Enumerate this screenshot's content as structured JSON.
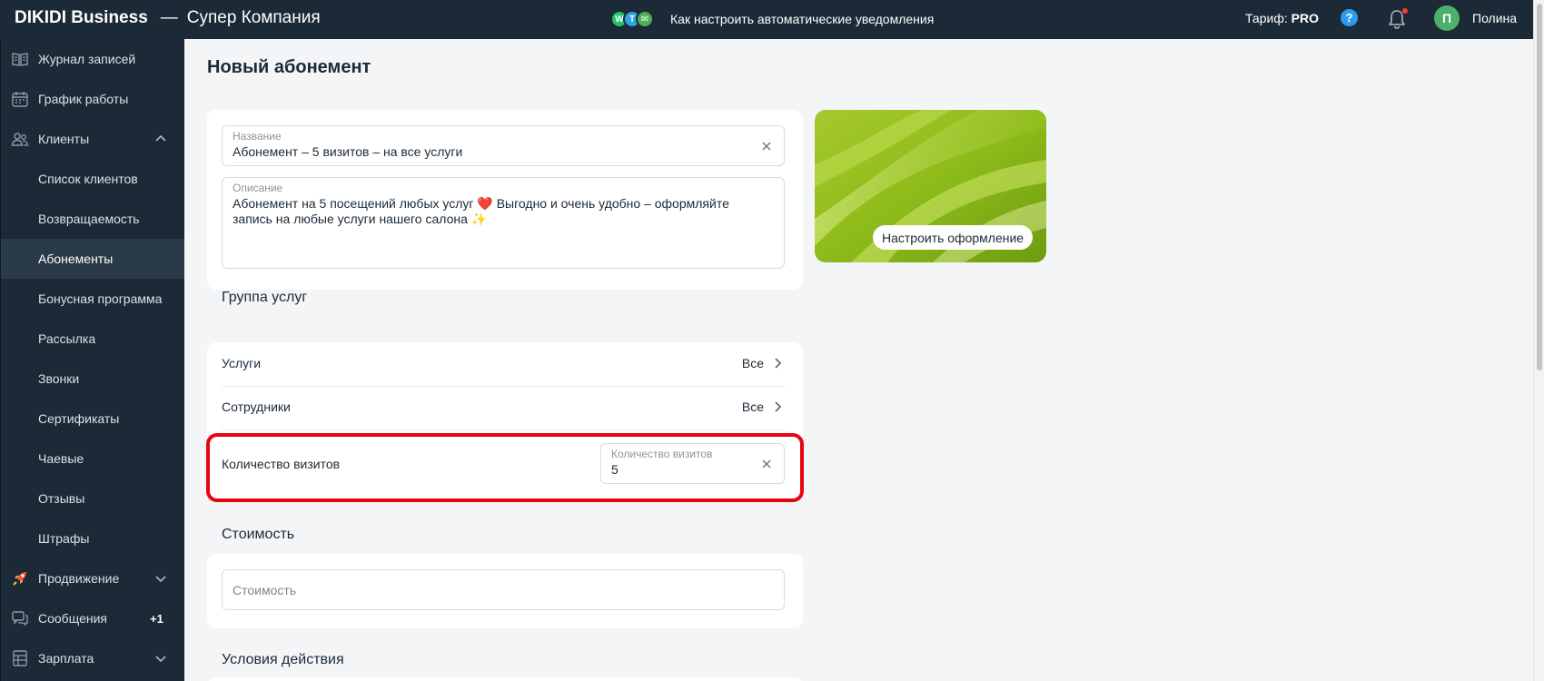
{
  "header": {
    "brand": "DIKIDI Business",
    "company": "Супер Компания",
    "promo_text": "Как настроить автоматические уведомления",
    "tariff_label": "Тариф:",
    "tariff_value": "PRO",
    "help_icon": "question-icon",
    "notifications_icon": "bell-icon",
    "avatar_letter": "П",
    "user_name": "Полина"
  },
  "sidebar": {
    "items": [
      {
        "label": "Журнал записей",
        "icon": "journal-icon"
      },
      {
        "label": "График работы",
        "icon": "calendar-icon"
      },
      {
        "label": "Клиенты",
        "icon": "clients-icon",
        "expanded": true
      },
      {
        "label": "Список клиентов"
      },
      {
        "label": "Возвращаемость"
      },
      {
        "label": "Абонементы",
        "active": true
      },
      {
        "label": "Бонусная программа"
      },
      {
        "label": "Рассылка"
      },
      {
        "label": "Звонки"
      },
      {
        "label": "Сертификаты"
      },
      {
        "label": "Чаевые"
      },
      {
        "label": "Отзывы"
      },
      {
        "label": "Штрафы"
      },
      {
        "label": "Продвижение",
        "icon": "rocket-icon"
      },
      {
        "label": "Сообщения",
        "icon": "messages-icon",
        "badge": "+1"
      },
      {
        "label": "Зарплата",
        "icon": "salary-icon"
      }
    ]
  },
  "main": {
    "page_title": "Новый абонемент",
    "name_field": {
      "label": "Название",
      "value": "Абонемент – 5 визитов – на все услуги"
    },
    "description_field": {
      "label": "Описание",
      "value": "Абонемент на 5 посещений любых услуг ❤️ Выгодно и очень удобно – оформляйте запись на любые услуги нашего салона ✨"
    },
    "design_button": "Настроить оформление",
    "services_group": {
      "title": "Группа услуг",
      "services": {
        "label": "Услуги",
        "value": "Все"
      },
      "staff": {
        "label": "Сотрудники",
        "value": "Все"
      },
      "visits": {
        "label": "Количество визитов",
        "field_label": "Количество визитов",
        "field_value": "5"
      }
    },
    "cost": {
      "title": "Стоимость",
      "placeholder": "Стоимость"
    },
    "conditions": {
      "title": "Условия действия"
    }
  },
  "colors": {
    "topbar_bg": "#1c2a38",
    "page_bg": "#f4f5f7",
    "highlight": "#e8050f",
    "accent_green": "#9ac21f"
  }
}
